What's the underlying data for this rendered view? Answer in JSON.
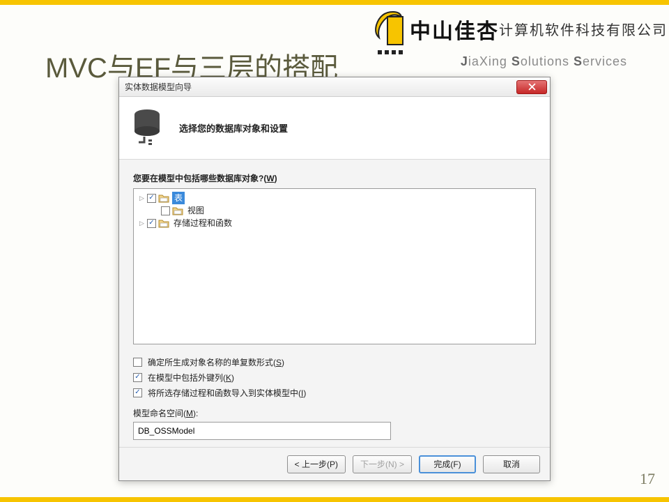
{
  "company": {
    "name_cn_big": "中山佳杏",
    "name_cn_small": "计算机软件科技有限公司",
    "name_en_html": "JiaXing Solutions Services"
  },
  "slide": {
    "title_latin_1": "MVC",
    "title_cn_1": "与",
    "title_latin_2": "EF",
    "title_cn_2": "与三层的搭配",
    "page_number": "17"
  },
  "dialog": {
    "title": "实体数据模型向导",
    "banner": "选择您的数据库对象和设置",
    "prompt": "您要在模型中包括哪些数据库对象?(",
    "prompt_key": "W",
    "prompt_suffix": ")",
    "tree": {
      "items": [
        {
          "label": "表",
          "expanded": false,
          "checked": true,
          "selected": true,
          "expandable": true
        },
        {
          "label": "视图",
          "expanded": false,
          "checked": false,
          "selected": false,
          "expandable": false
        },
        {
          "label": "存储过程和函数",
          "expanded": false,
          "checked": true,
          "selected": false,
          "expandable": true
        }
      ]
    },
    "options": {
      "pluralize": {
        "checked": false,
        "text": "确定所生成对象名称的单复数形式(",
        "key": "S",
        "suffix": ")"
      },
      "fkeys": {
        "checked": true,
        "text": "在模型中包括外键列(",
        "key": "K",
        "suffix": ")"
      },
      "importsp": {
        "checked": true,
        "text": "将所选存储过程和函数导入到实体模型中(",
        "key": "I",
        "suffix": ")"
      }
    },
    "namespace": {
      "label": "模型命名空间(",
      "key": "M",
      "suffix": "):",
      "value": "DB_OSSModel"
    },
    "buttons": {
      "prev": "< 上一步(P)",
      "next": "下一步(N) >",
      "finish": "完成(F)",
      "cancel": "取消"
    }
  }
}
